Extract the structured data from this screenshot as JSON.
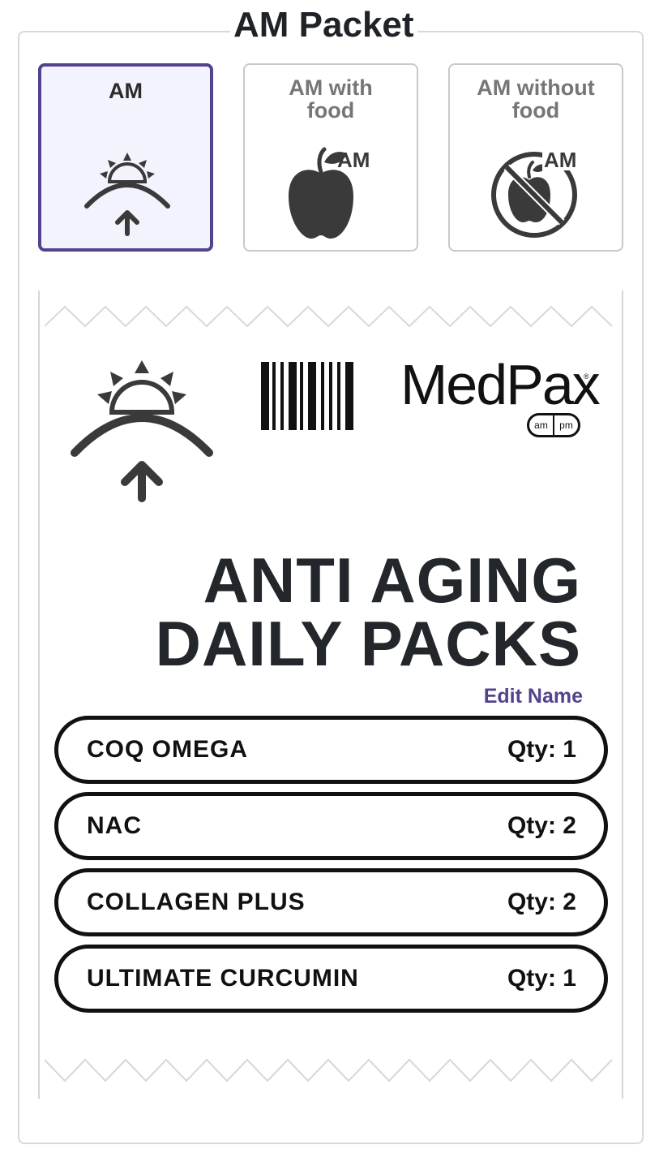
{
  "header": {
    "title": "AM Packet"
  },
  "options": [
    {
      "label": "AM",
      "selected": true,
      "icon": "sunrise-icon"
    },
    {
      "label": "AM with food",
      "line1": "AM with",
      "line2": "food",
      "selected": false,
      "icon": "apple-am-icon",
      "badge": "AM"
    },
    {
      "label": "AM without food",
      "line1": "AM without",
      "line2": "food",
      "selected": false,
      "icon": "no-apple-am-icon",
      "badge": "AM"
    }
  ],
  "packet": {
    "brand": "MedPax",
    "brand_mark": "®",
    "pill_left": "am",
    "pill_right": "pm",
    "title_line1": "ANTI AGING",
    "title_line2": "DAILY PACKS",
    "edit_label": "Edit Name",
    "items": [
      {
        "name": "COQ OMEGA",
        "qty": "Qty: 1"
      },
      {
        "name": "NAC",
        "qty": "Qty: 2"
      },
      {
        "name": "COLLAGEN PLUS",
        "qty": "Qty: 2"
      },
      {
        "name": "ULTIMATE CURCUMIN",
        "qty": "Qty: 1"
      }
    ]
  },
  "colors": {
    "accent": "#54428e",
    "selected_bg": "#f3f3fd",
    "text": "#1f2328",
    "muted": "#767676"
  }
}
